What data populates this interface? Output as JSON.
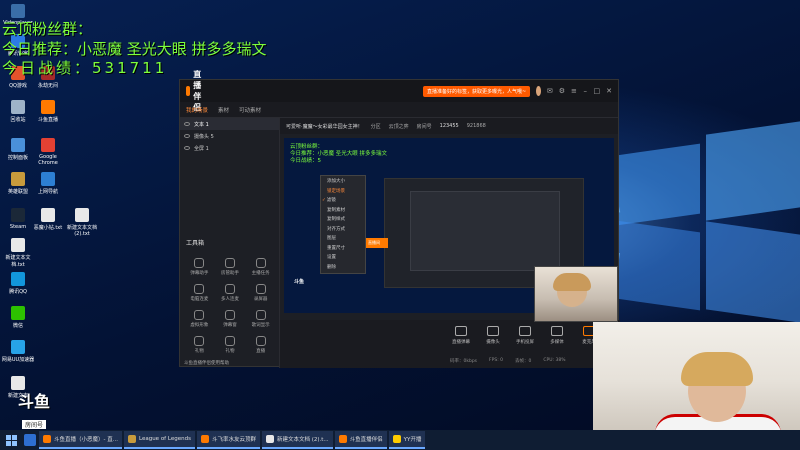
{
  "overlay": {
    "title": "云顶粉丝群：",
    "recommend": "今日推荐：小恶魔 圣光大眼 拼多多瑞文",
    "record": "今日战绩：531711"
  },
  "desktop_icons": [
    {
      "label": "Videoplayer",
      "icon": "video-icon",
      "color": "#3a6ea8"
    },
    {
      "label": "腾讯管家",
      "icon": "shield-icon",
      "color": "#2c7be5"
    },
    {
      "label": "QQ游戏",
      "icon": "game-icon",
      "color": "#e5532c"
    },
    {
      "label": "回收站",
      "icon": "recycle-bin-icon",
      "color": "#9fb3c8"
    },
    {
      "label": "控制面板",
      "icon": "control-panel-icon",
      "color": "#4a90d9"
    },
    {
      "label": "英雄联盟",
      "icon": "lol-icon",
      "color": "#c89b3c"
    },
    {
      "label": "Steam",
      "icon": "steam-icon",
      "color": "#1b2838"
    },
    {
      "label": "新建文本文档.txt",
      "icon": "text-file-icon",
      "color": "#e8e8e8"
    },
    {
      "label": "腾讯QQ",
      "icon": "qq-icon",
      "color": "#1296db"
    },
    {
      "label": "微信",
      "icon": "wechat-icon",
      "color": "#2dc100"
    },
    {
      "label": "网易UU加速器",
      "icon": "uu-icon",
      "color": "#27a3e8"
    },
    {
      "label": "新建文本",
      "icon": "text-file-icon",
      "color": "#e8e8e8"
    },
    {
      "label": "永劫无间",
      "icon": "game-icon",
      "color": "#a52a2a"
    },
    {
      "label": "斗鱼直播",
      "icon": "douyu-icon",
      "color": "#ff7a00"
    },
    {
      "label": "Google Chrome",
      "icon": "chrome-icon",
      "color": "#e34133"
    },
    {
      "label": "上网导航",
      "icon": "browser-icon",
      "color": "#2d7fd3"
    },
    {
      "label": "恶魔小钻.txt",
      "icon": "text-file-icon",
      "color": "#e8e8e8"
    },
    {
      "label": "新建文本文档(2).txt",
      "icon": "text-file-icon",
      "color": "#e8e8e8"
    }
  ],
  "app": {
    "name": "直播伴侣",
    "banner": "直播准备好的标签，获取更多曝光，人气哦~",
    "tabs": [
      "我的场景",
      "素材",
      "可动素材"
    ],
    "active_tab": 0,
    "scenes": [
      "文本 1",
      "摄像头 5",
      "全屏 1"
    ],
    "tools_label": "工具箱",
    "tools": [
      "弹幕助手",
      "房管助手",
      "主播任务",
      "电脑连麦",
      "多人连麦",
      "录屏器",
      "虚拟形象",
      "弹幕窗",
      "歌词显示",
      "礼物",
      "礼物",
      "直播"
    ],
    "notice": "斗鱼直播伴侣使用帮助",
    "info_bar": {
      "room_title": "可爱听·魔魔～女彩最华园女主神！",
      "category_label": "分区",
      "category": "云顶之弈",
      "room_id_label": "房间号",
      "room_id": "123455",
      "viewers": "921868"
    },
    "context_menu": [
      "添加大小",
      "锁定场景",
      "滤镜",
      "复制素材",
      "复制样式",
      "对齐方式",
      "图层",
      "重置尺寸",
      "设置",
      "删除"
    ],
    "preview_overlay": [
      "云顶粉丝群：",
      "今日推荐：小恶魔 圣光大眼 拼多多瑞文",
      "今日战绩：5"
    ],
    "preview_orange": "开播啦，直播间",
    "preview_logo": "斗鱼",
    "controls": [
      "直播弹幕",
      "摄像头",
      "手机投屏",
      "多媒体",
      "麦克风",
      "扬声器"
    ],
    "status": [
      "码率：0kbps",
      "FPS: 0",
      "丢帧：0",
      "CPU: 38%"
    ]
  },
  "douyu": {
    "logo": "斗鱼",
    "sub": "房间号",
    "room_id": "123455"
  },
  "taskbar": {
    "apps": [
      {
        "label": "斗鱼直播（小恶魔）- 直...",
        "color": "#ff7a00"
      },
      {
        "label": "League of Legends",
        "color": "#c89b3c"
      },
      {
        "label": "斗飞率水友云顶群",
        "color": "#ff7a00"
      },
      {
        "label": "新建文本文档 (2).t...",
        "color": "#e8e8e8"
      },
      {
        "label": "斗鱼直播伴侣",
        "color": "#ff7a00"
      },
      {
        "label": "YY开播",
        "color": "#ffcc00"
      }
    ]
  }
}
